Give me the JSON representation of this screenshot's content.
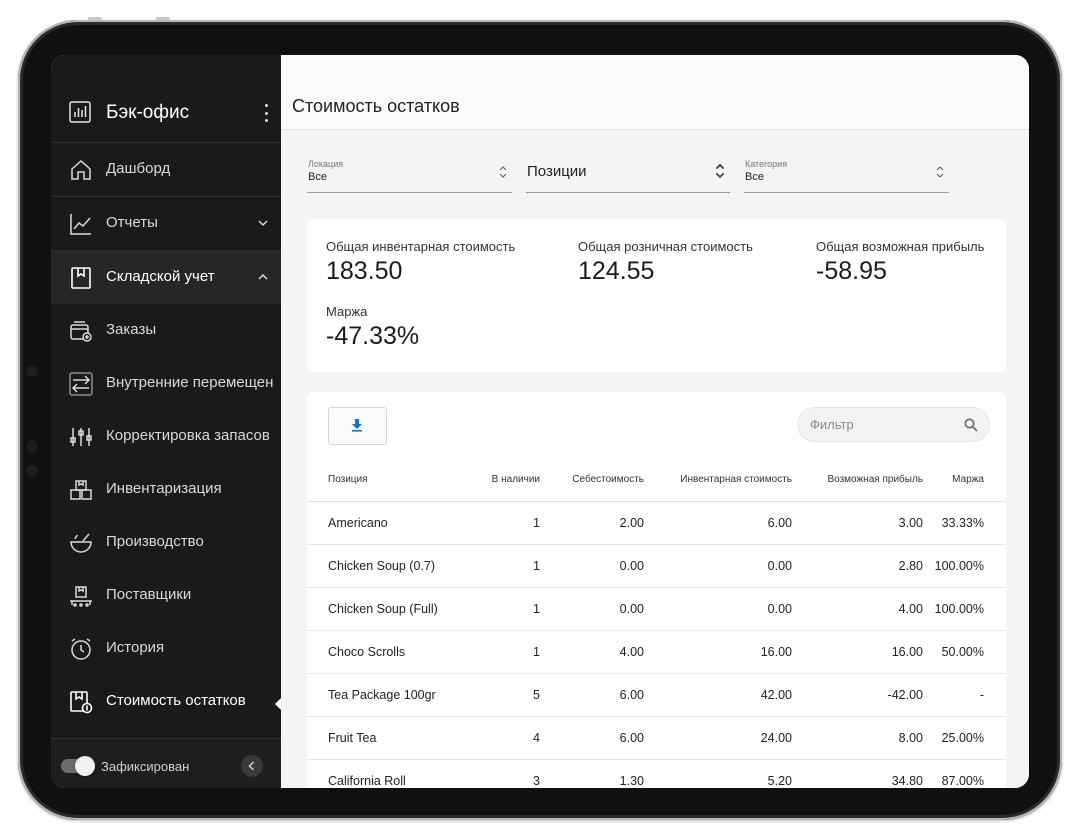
{
  "sidebar": {
    "title": "Бэк-офис",
    "items": [
      {
        "label": "Дашборд",
        "icon": "home-icon"
      },
      {
        "label": "Отчеты",
        "icon": "chart-line-icon"
      },
      {
        "label": "Складской учет",
        "icon": "inventory-book-icon"
      },
      {
        "label": "Заказы",
        "icon": "order-box-icon"
      },
      {
        "label": "Внутренние перемещен",
        "icon": "transfer-icon"
      },
      {
        "label": "Корректировка запасов",
        "icon": "sliders-icon"
      },
      {
        "label": "Инвентаризация",
        "icon": "boxes-icon"
      },
      {
        "label": "Производство",
        "icon": "bowl-icon"
      },
      {
        "label": "Поставщики",
        "icon": "supplier-icon"
      },
      {
        "label": "История",
        "icon": "history-icon"
      },
      {
        "label": "Стоимость остатков",
        "icon": "stock-value-icon"
      }
    ],
    "footer": {
      "toggle_label": "Зафиксирован"
    }
  },
  "page": {
    "title": "Стоимость остатков"
  },
  "filters": {
    "location": {
      "caption": "Локация",
      "value": "Все"
    },
    "positions": {
      "value": "Позиции"
    },
    "category": {
      "caption": "Категория",
      "value": "Все"
    }
  },
  "stats": {
    "inventory": {
      "label": "Общая инвентарная стоимость",
      "value": "183.50"
    },
    "retail": {
      "label": "Общая розничная стоимость",
      "value": "124.55"
    },
    "profit": {
      "label": "Общая возможная прибыль",
      "value": "-58.95"
    },
    "margin": {
      "label": "Маржа",
      "value": "-47.33%"
    }
  },
  "table": {
    "filter_placeholder": "Фильтр",
    "headers": [
      "Позиция",
      "В наличии",
      "Себестоимость",
      "Инвентарная стоимость",
      "Возможная прибыль",
      "Маржа"
    ],
    "rows": [
      [
        "Americano",
        "1",
        "2.00",
        "6.00",
        "3.00",
        "33.33%"
      ],
      [
        "Chicken Soup (0.7)",
        "1",
        "0.00",
        "0.00",
        "2.80",
        "100.00%"
      ],
      [
        "Chicken Soup (Full)",
        "1",
        "0.00",
        "0.00",
        "4.00",
        "100.00%"
      ],
      [
        "Choco Scrolls",
        "1",
        "4.00",
        "16.00",
        "16.00",
        "50.00%"
      ],
      [
        "Tea Package 100gr",
        "5",
        "6.00",
        "42.00",
        "-42.00",
        "-"
      ],
      [
        "Fruit Tea",
        "4",
        "6.00",
        "24.00",
        "8.00",
        "25.00%"
      ],
      [
        "California Roll",
        "3",
        "1.30",
        "5.20",
        "34.80",
        "87.00%"
      ]
    ]
  },
  "colors": {
    "accent": "#1f6fd1",
    "sidebar_bg": "#1a1a1a"
  }
}
